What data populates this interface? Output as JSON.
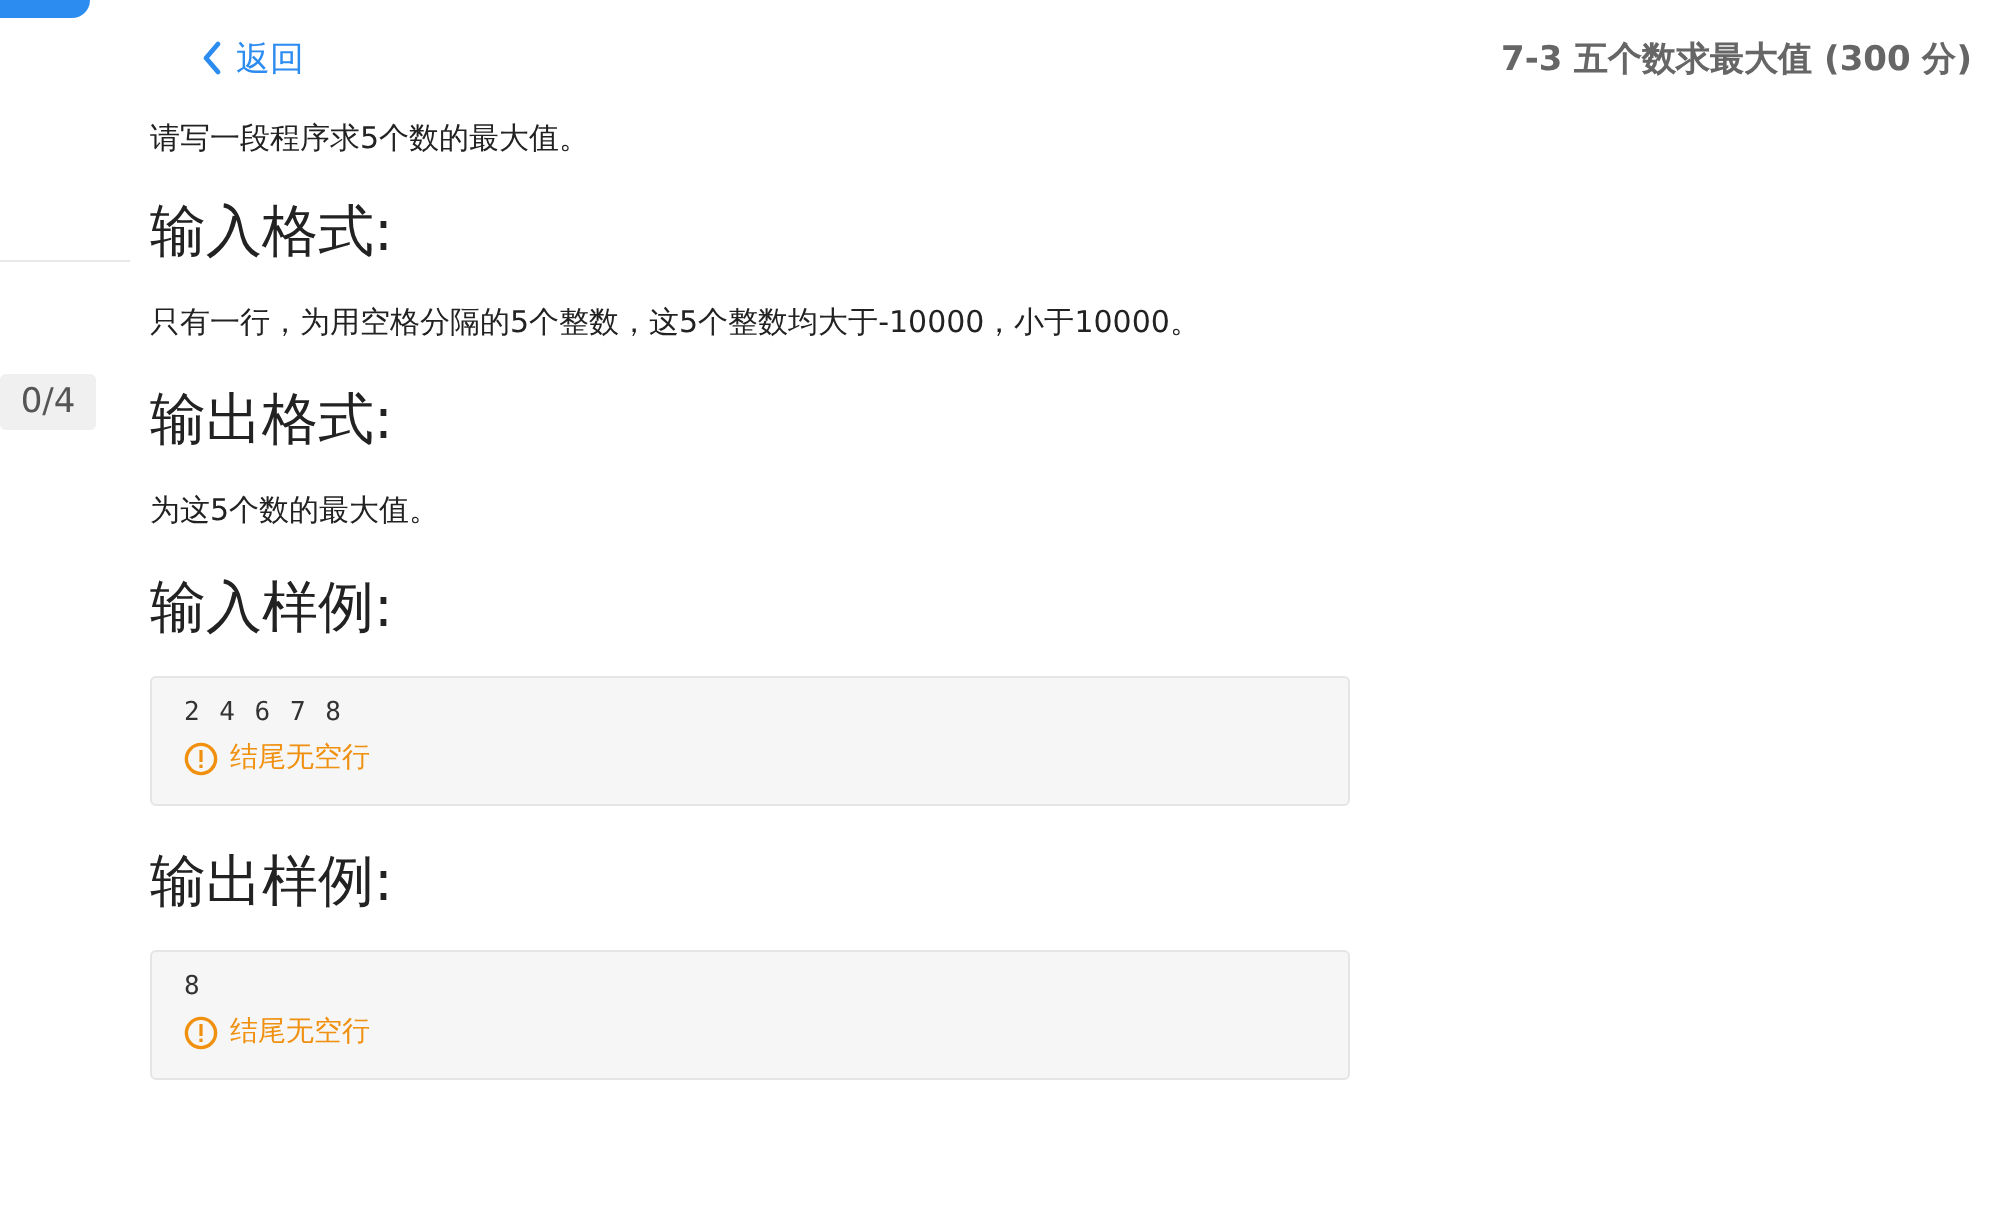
{
  "header": {
    "back_link": "返回",
    "title": "7-3 五个数求最大值 (300 分)"
  },
  "sidebar": {
    "progress_badge": "0/4"
  },
  "problem": {
    "description": "请写一段程序求5个数的最大值。",
    "sections": [
      {
        "kind": "text",
        "heading": "输入格式:",
        "body": "只有一行，为用空格分隔的5个整数，这5个整数均大于-10000，小于10000。"
      },
      {
        "kind": "text",
        "heading": "输出格式:",
        "body": "为这5个数的最大值。"
      },
      {
        "kind": "sample",
        "heading": "输入样例:",
        "code": "2 4 6 7 8",
        "note": "结尾无空行"
      },
      {
        "kind": "sample",
        "heading": "输出样例:",
        "code": "8",
        "note": "结尾无空行"
      }
    ]
  }
}
